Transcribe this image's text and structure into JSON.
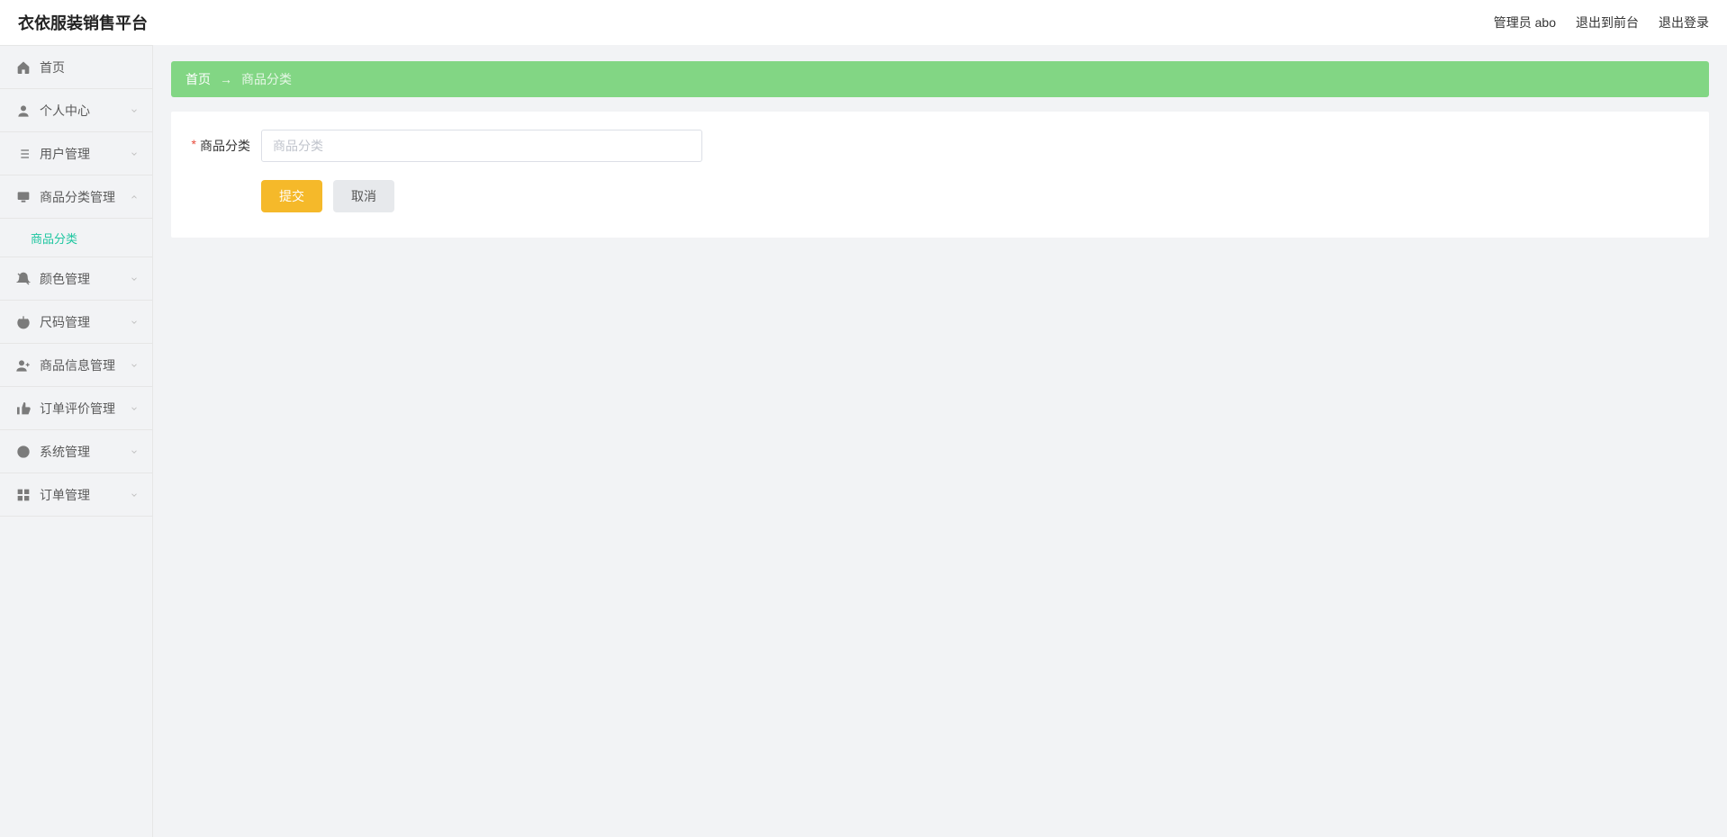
{
  "header": {
    "brand": "衣依服装销售平台",
    "admin_label": "管理员 abo",
    "to_front_label": "退出到前台",
    "logout_label": "退出登录"
  },
  "breadcrumb": {
    "home": "首页",
    "separator": "→",
    "current": "商品分类"
  },
  "sidebar": {
    "items": [
      {
        "icon": "home-icon",
        "label": "首页",
        "expandable": false
      },
      {
        "icon": "user-icon",
        "label": "个人中心",
        "expandable": true,
        "open": false
      },
      {
        "icon": "list-icon",
        "label": "用户管理",
        "expandable": true,
        "open": false
      },
      {
        "icon": "monitor-icon",
        "label": "商品分类管理",
        "expandable": true,
        "open": true,
        "children": [
          {
            "label": "商品分类"
          }
        ]
      },
      {
        "icon": "bell-off-icon",
        "label": "颜色管理",
        "expandable": true,
        "open": false
      },
      {
        "icon": "power-icon",
        "label": "尺码管理",
        "expandable": true,
        "open": false
      },
      {
        "icon": "user-plus-icon",
        "label": "商品信息管理",
        "expandable": true,
        "open": false
      },
      {
        "icon": "thumbs-up-icon",
        "label": "订单评价管理",
        "expandable": true,
        "open": false
      },
      {
        "icon": "target-icon",
        "label": "系统管理",
        "expandable": true,
        "open": false
      },
      {
        "icon": "grid-icon",
        "label": "订单管理",
        "expandable": true,
        "open": false
      }
    ]
  },
  "form": {
    "category_label": "商品分类",
    "category_placeholder": "商品分类",
    "category_value": "",
    "submit_label": "提交",
    "cancel_label": "取消"
  }
}
